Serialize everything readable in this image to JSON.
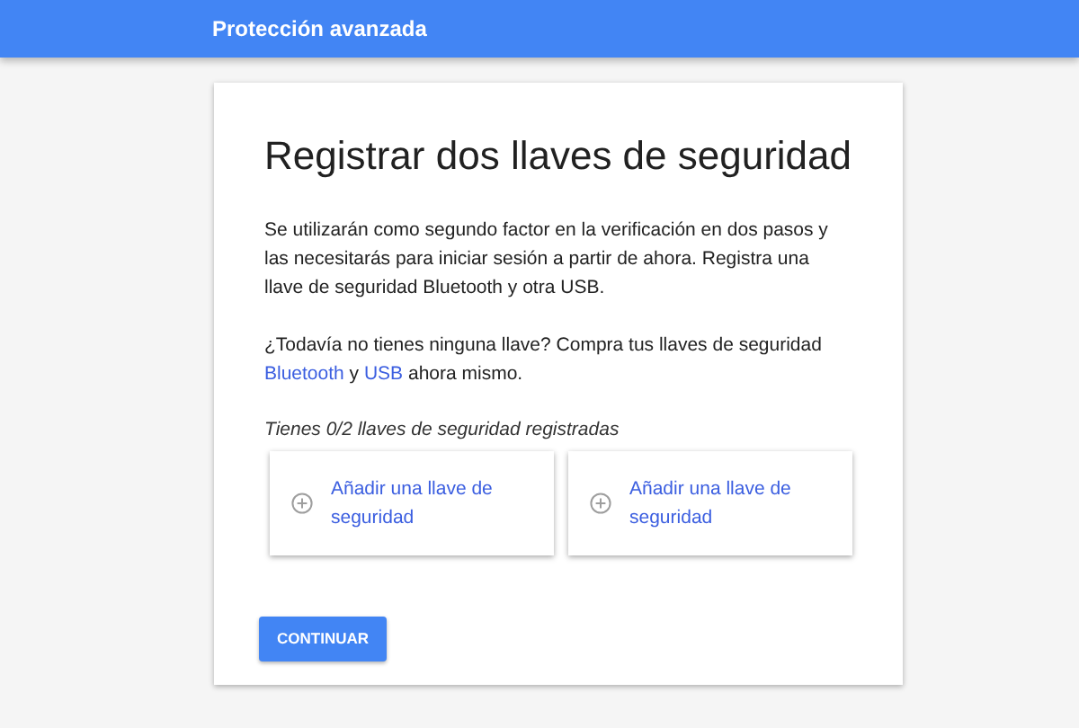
{
  "header": {
    "title": "Protección avanzada"
  },
  "card": {
    "title": "Registrar dos llaves de seguridad",
    "intro": "Se utilizarán como segundo factor en la verificación en dos pasos y las necesitarás para iniciar sesión a partir de ahora. Registra una llave de seguridad Bluetooth y otra USB.",
    "purchase": [
      {
        "kind": "text",
        "text": "¿Todavía no tienes ninguna llave? Compra tus llaves de seguridad "
      },
      {
        "kind": "link",
        "text": "Bluetooth"
      },
      {
        "kind": "text",
        "text": " y "
      },
      {
        "kind": "link",
        "text": "USB"
      },
      {
        "kind": "text",
        "text": " ahora mismo."
      }
    ],
    "status": "Tienes 0/2 llaves de seguridad registradas",
    "keys": [
      {
        "label": "Añadir una llave de seguridad"
      },
      {
        "label": "Añadir una llave de seguridad"
      }
    ],
    "button": "CONTINUAR"
  }
}
